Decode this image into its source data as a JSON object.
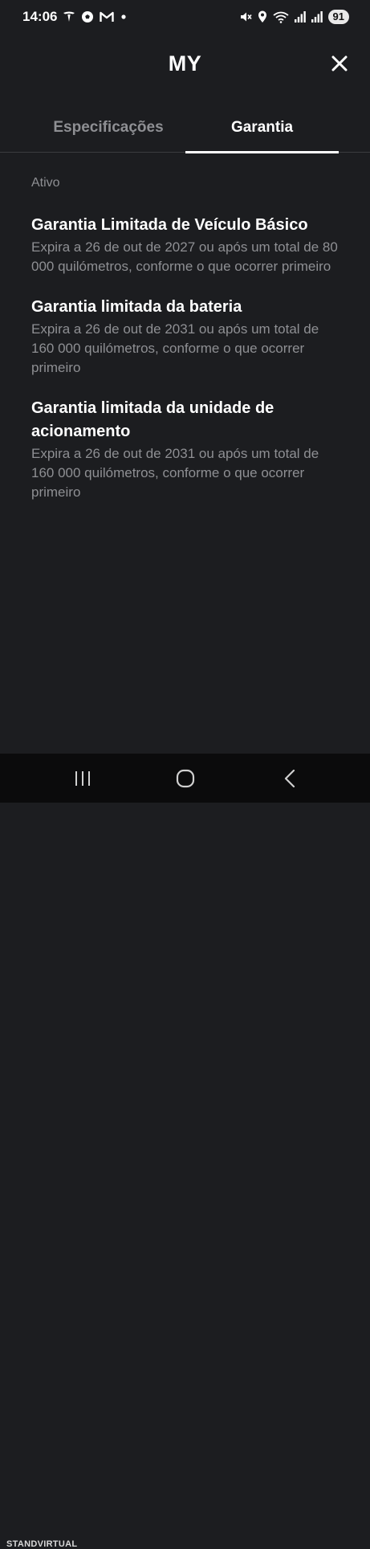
{
  "status_bar": {
    "time": "14:06",
    "battery": "91",
    "left_icons": [
      "tesla-icon",
      "soccer-ball-icon",
      "gmail-icon",
      "dot-icon"
    ],
    "right_icons": [
      "mute-icon",
      "location-icon",
      "wifi-icon",
      "signal-icon",
      "signal-icon",
      "battery-icon"
    ]
  },
  "header": {
    "title": "MY",
    "close_icon": "close-icon"
  },
  "tabs": [
    {
      "label": "Especificações",
      "active": false
    },
    {
      "label": "Garantia",
      "active": true
    }
  ],
  "section": {
    "label": "Ativo"
  },
  "warranties": [
    {
      "title": "Garantia Limitada de Veículo Básico",
      "description": "Expira a 26 de out de 2027 ou após um total de 80 000 quilómetros, conforme o que ocorrer primeiro"
    },
    {
      "title": "Garantia limitada da bateria",
      "description": "Expira a 26 de out de 2031 ou após um total de 160 000 quilómetros, conforme o que ocorrer primeiro"
    },
    {
      "title": "Garantia limitada da unidade de acionamento",
      "description": "Expira a 26 de out de 2031 ou após um total de 160 000 quilómetros, conforme o que ocorrer primeiro"
    }
  ],
  "nav_bar": {
    "buttons": [
      "recent-apps-icon",
      "home-icon",
      "back-icon"
    ]
  },
  "watermark": "STANDVIRTUAL",
  "colors": {
    "background": "#1c1d20",
    "text_primary": "#ffffff",
    "text_secondary": "#8e8f93",
    "divider": "#3a3b3f",
    "nav_background": "#0b0b0c"
  }
}
